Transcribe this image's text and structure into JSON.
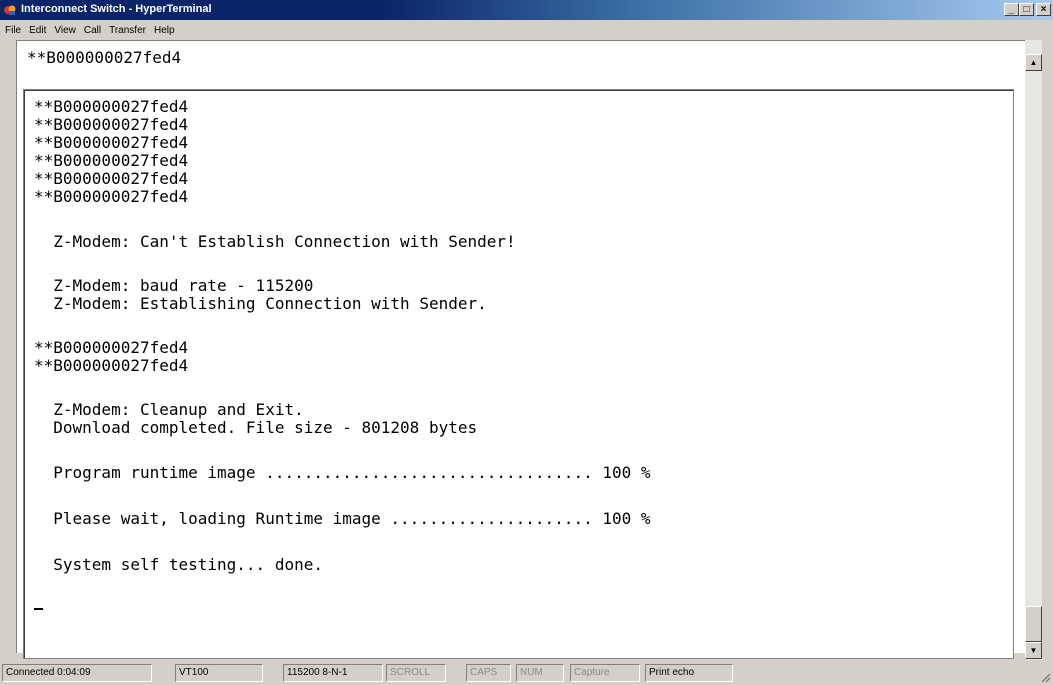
{
  "window": {
    "title": "Interconnect Switch - HyperTerminal",
    "controls": {
      "minimize": "_",
      "maximize": "□",
      "close": "×"
    }
  },
  "menu": [
    "File",
    "Edit",
    "View",
    "Call",
    "Transfer",
    "Help"
  ],
  "terminal": {
    "scrollback_line": "**B000000027fed4",
    "lines": [
      "**B000000027fed4",
      "**B000000027fed4",
      "**B000000027fed4",
      "**B000000027fed4",
      "**B000000027fed4",
      "**B000000027fed4",
      "  Z-Modem: Can't Establish Connection with Sender!",
      "  Z-Modem: baud rate - 115200",
      "  Z-Modem: Establishing Connection with Sender.",
      "**B000000027fed4",
      "**B000000027fed4",
      "  Z-Modem: Cleanup and Exit.",
      "  Download completed. File size - 801208 bytes",
      "  Program runtime image .................................. 100 %",
      "  Please wait, loading Runtime image ..................... 100 %",
      "  System self testing... done."
    ]
  },
  "status": {
    "connected": "Connected 0:04:09",
    "emulation": "VT100",
    "settings": "115200 8-N-1",
    "scroll": "SCROLL",
    "caps": "CAPS",
    "num": "NUM",
    "capture": "Capture",
    "print_echo": "Print echo"
  }
}
